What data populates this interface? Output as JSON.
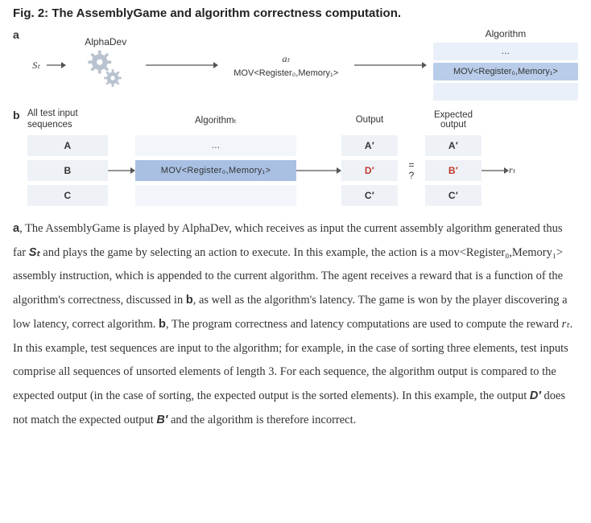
{
  "title": "Fig. 2: The AssemblyGame and algorithm correctness computation.",
  "panelA": {
    "label": "a",
    "alphadev": "AlphaDev",
    "s_t": "Sₜ",
    "a_t": "aₜ",
    "mov": "MOV<Register₀,Memory₁>",
    "algo_heading": "Algorithm",
    "slot1": "…",
    "slot2": "MOV<Register₀,Memory₁>",
    "slot3": ""
  },
  "panelB": {
    "label": "b",
    "col1": "All test input sequences",
    "col2": "Algorithmₜ",
    "col3": "Output",
    "col4": "Expected output",
    "inputs": [
      "A",
      "B",
      "C"
    ],
    "algrow1": "…",
    "algrow2": "MOV<Register₀,Memory₁>",
    "algrow3": "",
    "outputs": [
      "A′",
      "D′",
      "C′"
    ],
    "expected": [
      "A′",
      "B′",
      "C′"
    ],
    "eq": "=",
    "q": "?",
    "r_t": "rₜ"
  },
  "caption": {
    "p1a": "a",
    "p1": ", The AssemblyGame is played by AlphaDev, which receives as input the current assembly algorithm generated thus far ",
    "p1_st": "Sₜ",
    "p1b": " and plays the game by selecting an action to execute. In this example, the action is a mov<Register₀,Memory₁> assembly instruction, which is appended to the current algorithm. The agent receives a reward that is a function of the algorithm's correctness, discussed in ",
    "p1_b": "b",
    "p1c": ", as well as the algorithm's latency. The game is won by the player discovering a low latency, correct algorithm. ",
    "p2_b": "b",
    "p2a": ", The program correctness and latency computations are used to compute the reward ",
    "p2_rt": "rₜ",
    "p2b": ". In this example, test sequences are input to the algorithm; for example, in the case of sorting three elements, test inputs comprise all sequences of unsorted elements of length 3. For each sequence, the algorithm output is compared to the expected output (in the case of sorting, the expected output is the sorted elements). In this example, the output ",
    "p2_d": "D′",
    "p2c": " does not match the expected output ",
    "p2_bprime": "B′",
    "p2d": " and the algorithm is therefore incorrect."
  }
}
